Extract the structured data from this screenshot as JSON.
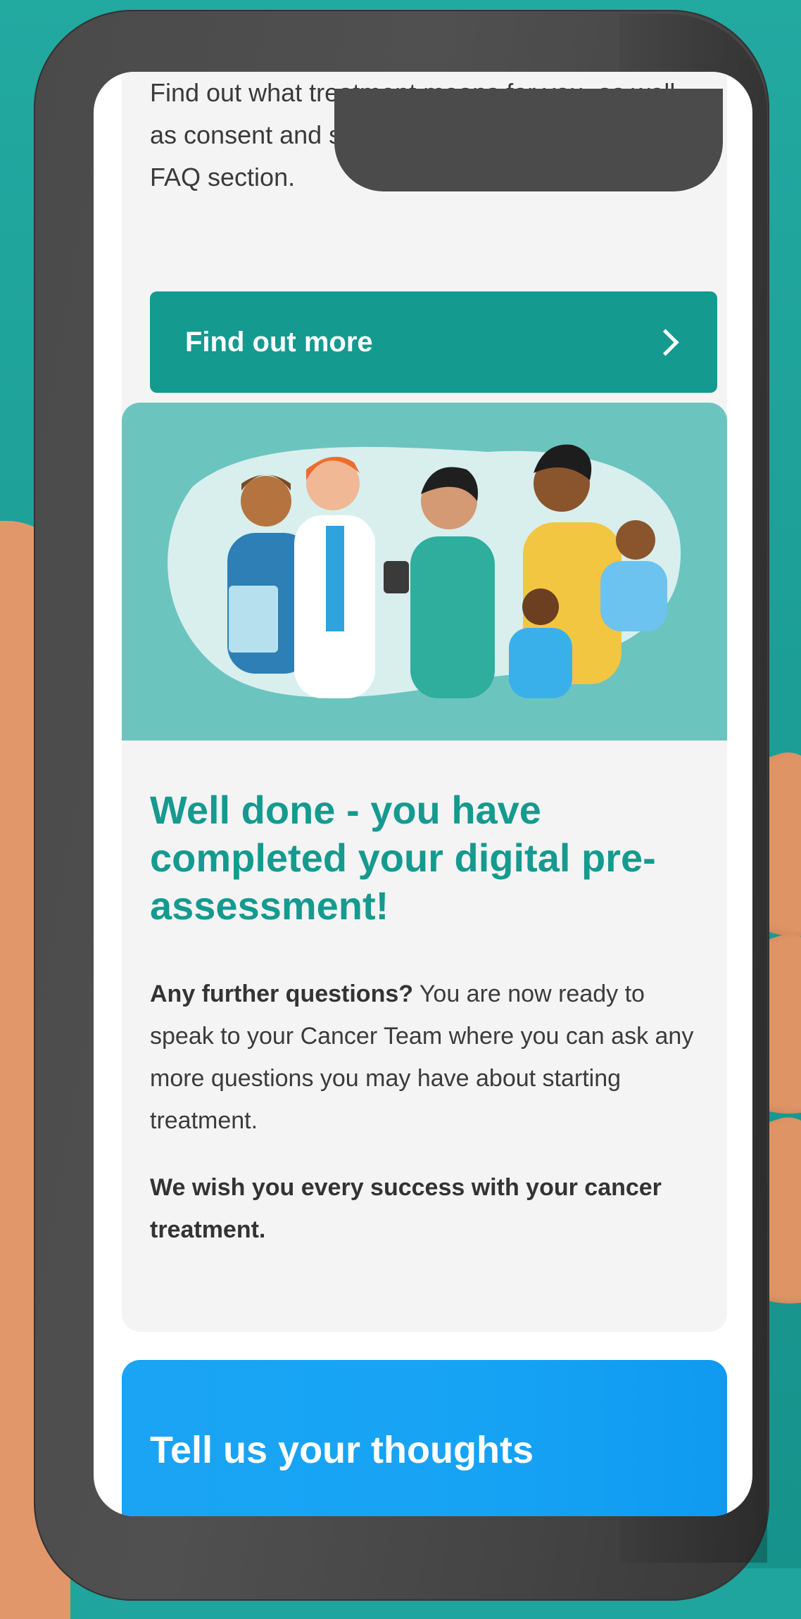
{
  "faq": {
    "text": "Find out what treatment means for you, as well as consent and shared decision making in our FAQ section.",
    "button_label": "Find out more"
  },
  "completion": {
    "title": "Well done - you have completed your digital pre-assessment!",
    "body_lead": "Any further questions?",
    "body_rest": " You are now ready to speak to your Cancer Team where you can ask any more questions you may have about starting treatment.",
    "closing": "We wish you every success with your cancer treatment."
  },
  "feedback": {
    "title": "Tell us your thoughts"
  },
  "colors": {
    "teal_accent": "#159a8f",
    "feedback_blue": "#17a3f4",
    "card_bg": "#f4f4f5",
    "backdrop_teal": "#1fa59d"
  }
}
